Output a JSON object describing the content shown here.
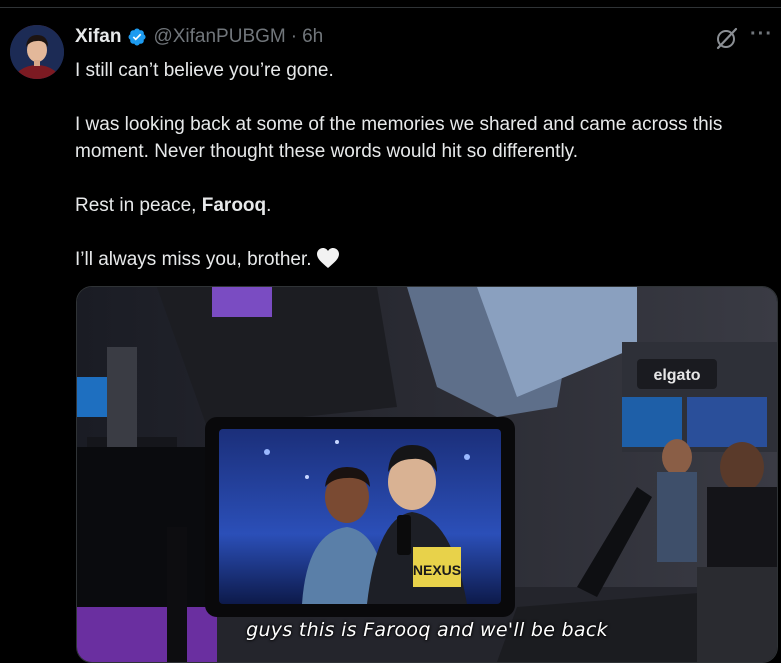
{
  "tweet": {
    "author_name": "Xifan",
    "handle": "@XifanPUBGM",
    "separator": "·",
    "timestamp": "6h",
    "verified": true,
    "more_label": "···",
    "text": {
      "line1": "I still can’t believe you’re gone.",
      "para2": "I was looking back at some of the memories we shared and came across this moment. Never thought these words would hit so differently.",
      "para3_prefix": "Rest in peace, ",
      "para3_name": "Farooq",
      "para3_suffix": ".",
      "para4": "I’ll always miss you, brother."
    },
    "media": {
      "subtitle": "guys this is Farooq and we'll be back",
      "sign_text": "elgato",
      "lanyard_text": "NEXUS"
    }
  },
  "colors": {
    "background": "#000000",
    "text_primary": "#e7e9ea",
    "text_secondary": "#71767b",
    "verified_blue": "#1d9bf0",
    "divider": "#2f3336"
  },
  "icons": {
    "verified": "verified-badge-icon",
    "grok": "grok-icon",
    "more": "more-options-icon",
    "heart": "white-heart-emoji"
  }
}
